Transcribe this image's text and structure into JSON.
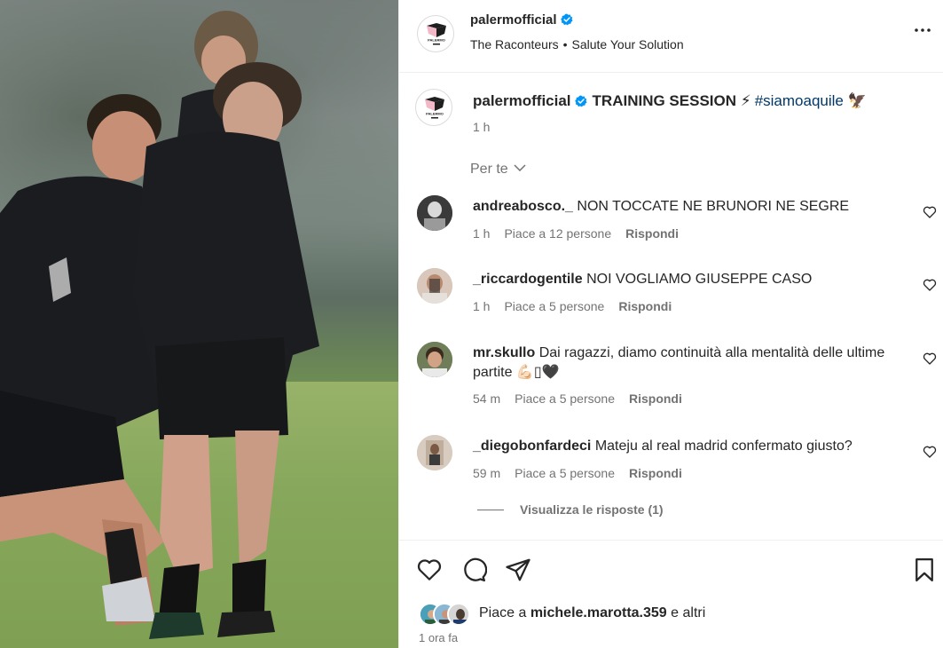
{
  "header": {
    "username": "palermofficial",
    "audio": {
      "artist": "The Raconteurs",
      "separator": "•",
      "track": "Salute Your Solution"
    },
    "more_label": "•••"
  },
  "logo": {
    "label": "PALERMO"
  },
  "caption": {
    "username": "palermofficial",
    "title": "TRAINING SESSION",
    "bolt_emoji": "⚡",
    "hashtag": "#siamoaquile",
    "eagle_emoji": "🦅",
    "time": "1 h"
  },
  "filter_label": "Per te",
  "comments": [
    {
      "username": "andreabosco._",
      "text": "NON TOCCATE NE BRUNORI NE SEGRE",
      "time": "1 h",
      "likes": "Piace a 12 persone",
      "reply": "Rispondi"
    },
    {
      "username": "_riccardogentile",
      "text": "NOI VOGLIAMO GIUSEPPE CASO",
      "time": "1 h",
      "likes": "Piace a 5 persone",
      "reply": "Rispondi"
    },
    {
      "username": "mr.skullo",
      "text": "Dai ragazzi, diamo continuità alla mentalità delle ultime partite",
      "emoji": "💪🏻▯🖤",
      "time": "54 m",
      "likes": "Piace a 5 persone",
      "reply": "Rispondi"
    },
    {
      "username": "_diegobonfardeci",
      "text": "Mateju al real madrid confermato giusto?",
      "time": "59 m",
      "likes": "Piace a 5 persone",
      "reply": "Rispondi"
    }
  ],
  "view_replies": "Visualizza le risposte (1)",
  "likes_line": {
    "prefix": "Piace a",
    "user": "michele.marotta.359",
    "suffix": "e altri"
  },
  "post_time": "1 ora fa",
  "colors": {
    "link": "#00376b",
    "verified": "#0095f6",
    "muted": "#737373",
    "text": "#262626"
  }
}
